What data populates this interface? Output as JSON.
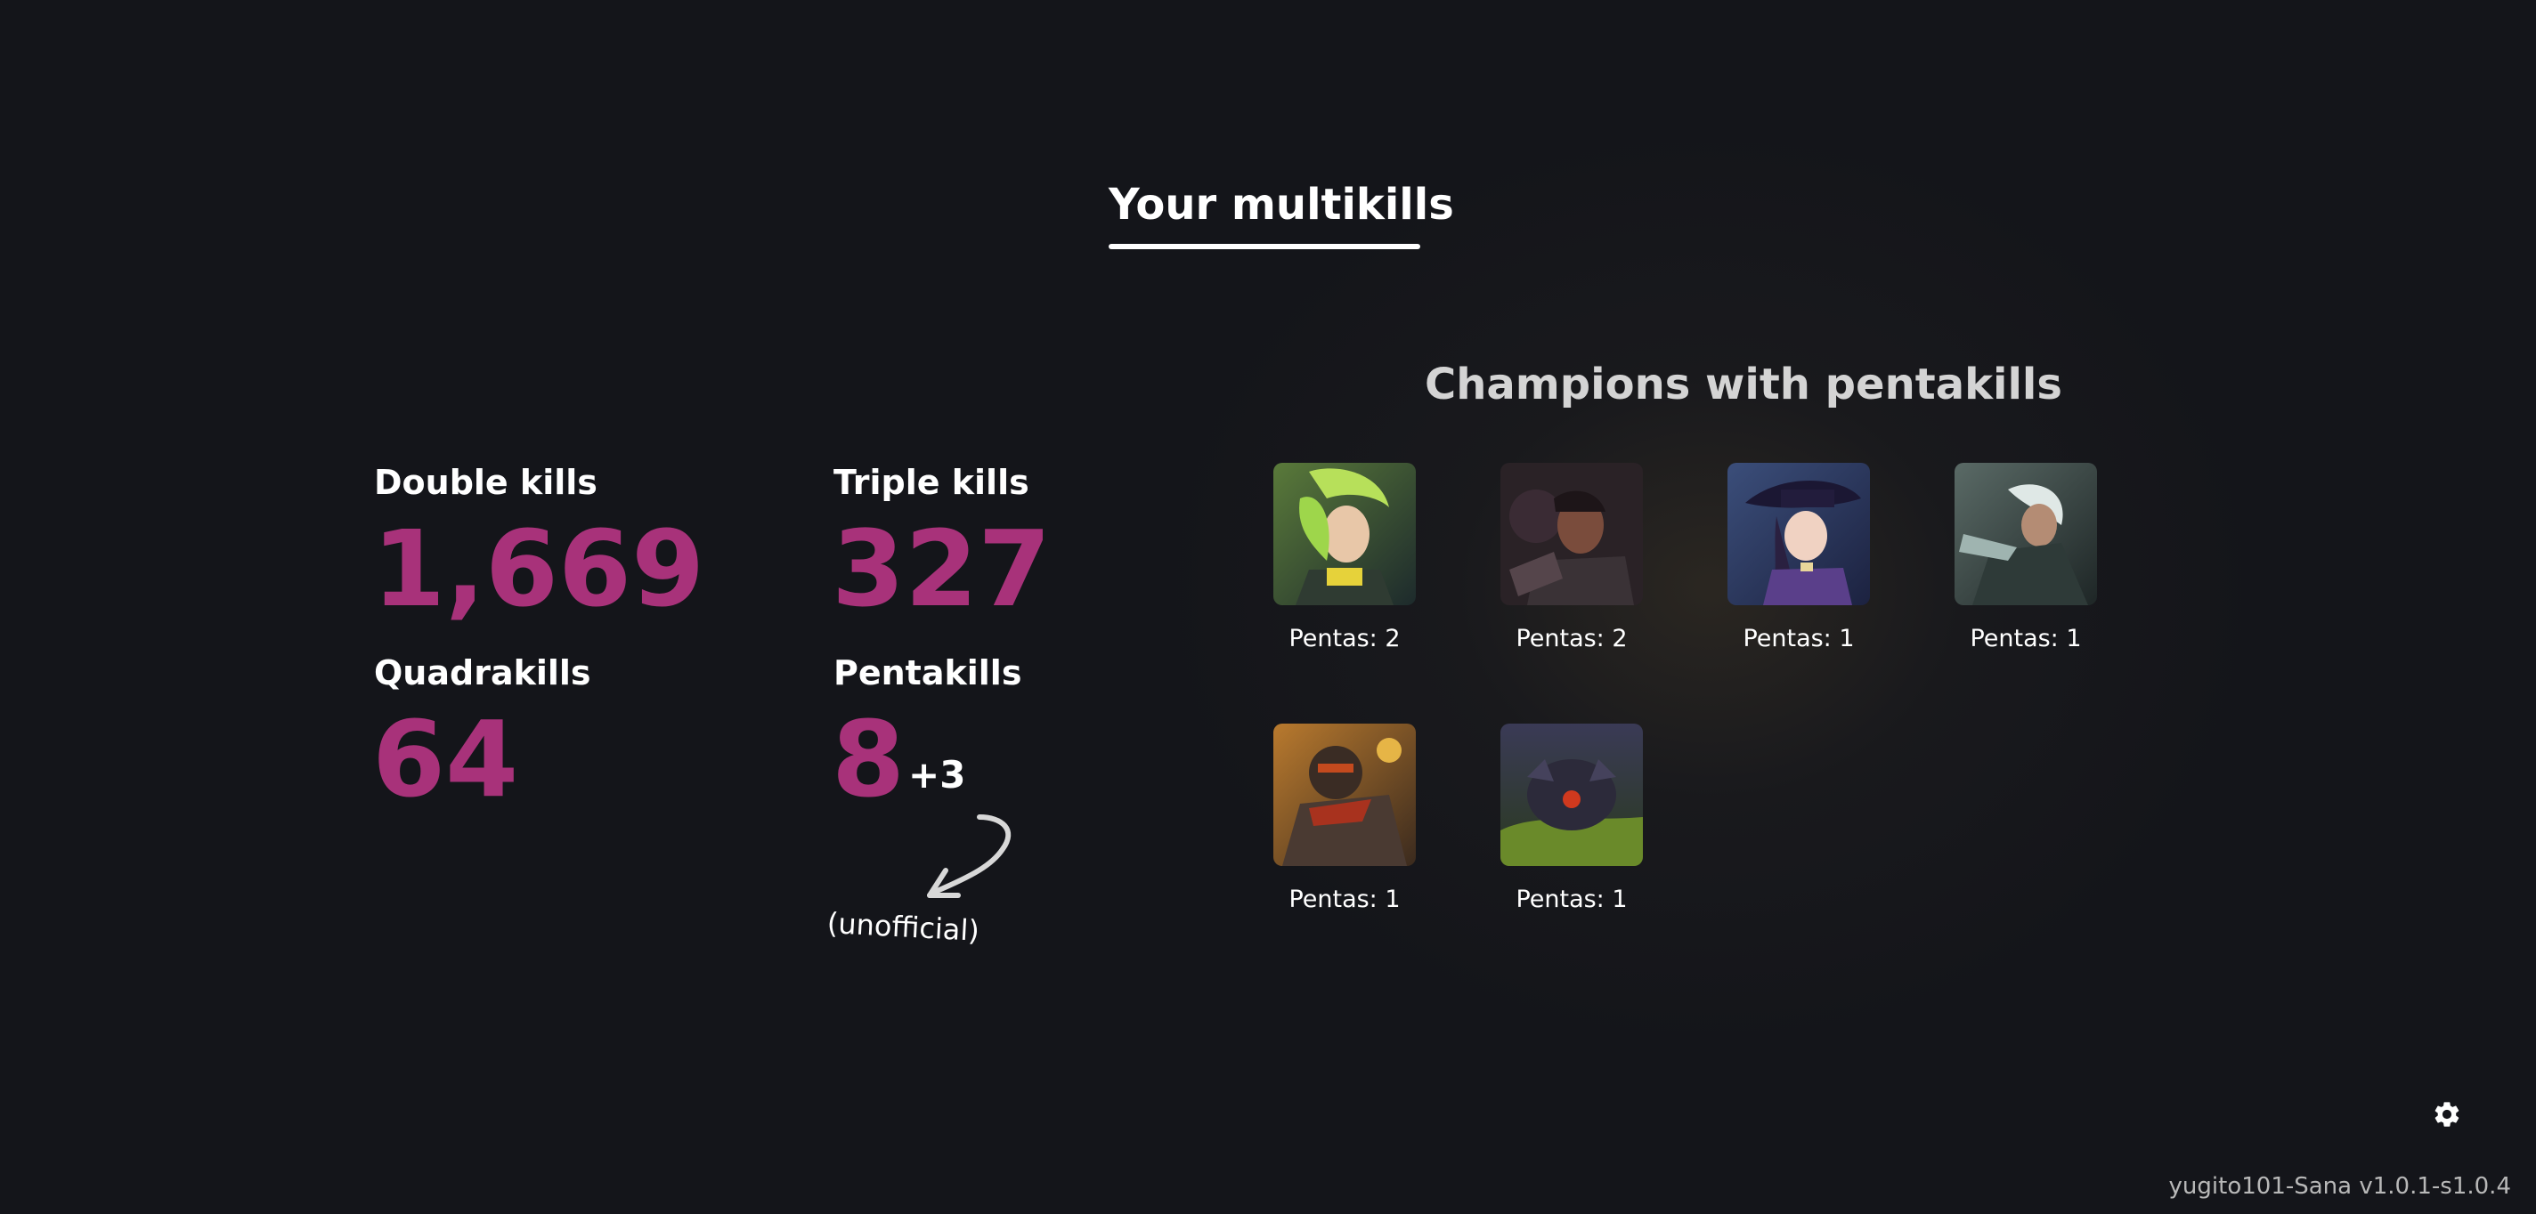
{
  "header": {
    "title": "Your multikills"
  },
  "stats": {
    "double": {
      "label": "Double kills",
      "value": "1,669"
    },
    "triple": {
      "label": "Triple kills",
      "value": "327"
    },
    "quadra": {
      "label": "Quadrakills",
      "value": "64"
    },
    "penta": {
      "label": "Pentakills",
      "value": "8",
      "bonus": "+3",
      "note": "(unofficial)"
    }
  },
  "champions": {
    "heading": "Champions with pentakills",
    "items": [
      {
        "label": "Pentas: 2",
        "icon": "champion-portrait-zeri"
      },
      {
        "label": "Pentas: 2",
        "icon": "champion-portrait-lucian"
      },
      {
        "label": "Pentas: 1",
        "icon": "champion-portrait-caitlyn"
      },
      {
        "label": "Pentas: 1",
        "icon": "champion-portrait-akshan"
      },
      {
        "label": "Pentas: 1",
        "icon": "champion-portrait-graves"
      },
      {
        "label": "Pentas: 1",
        "icon": "champion-portrait-kogmaw"
      }
    ]
  },
  "footer": {
    "version": "yugito101-Sana v1.0.1-s1.0.4",
    "settings_icon": "gear-icon"
  },
  "colors": {
    "background": "#14151a",
    "accent": "#a8327a"
  }
}
